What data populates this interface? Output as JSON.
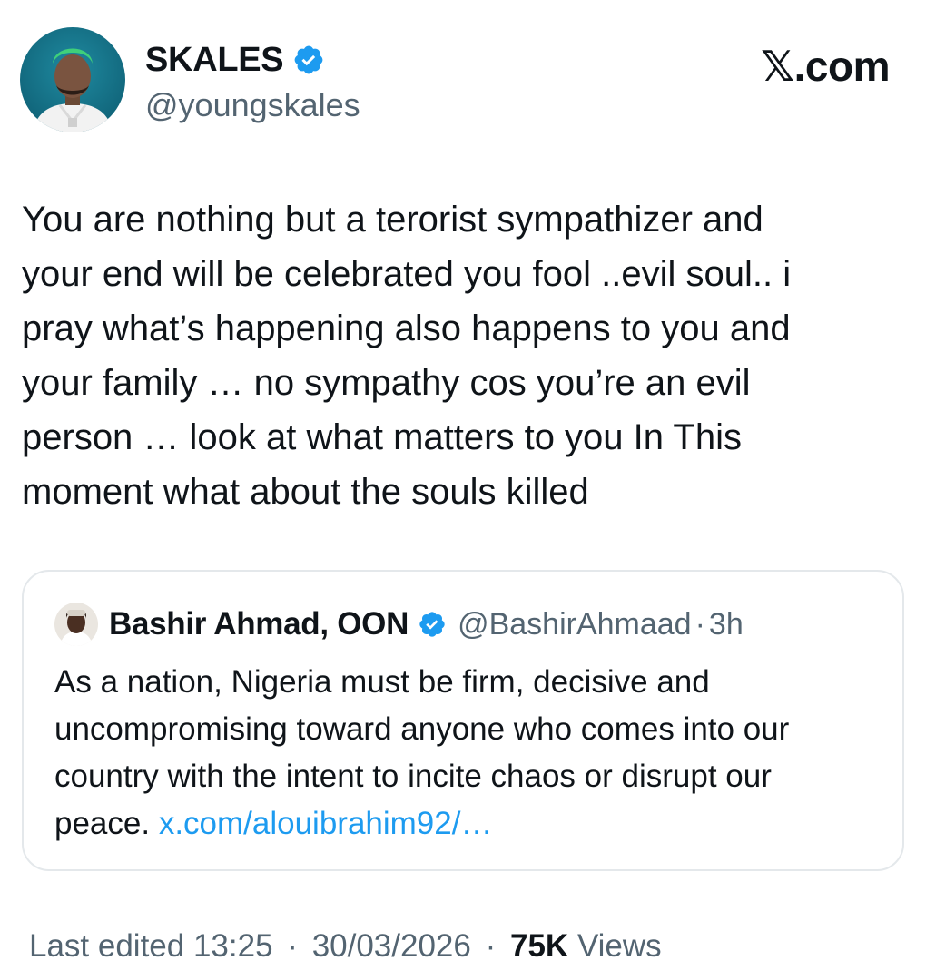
{
  "author": {
    "name": "SKALES",
    "handle": "@youngskales",
    "verified": true
  },
  "site_mark": "𝕏.com",
  "tweet": {
    "text": "You are nothing but a terorist sympathizer and\nyour end will be celebrated you fool ..evil soul.. i\npray what’s happening also happens to you and\nyour family … no sympathy cos you’re an evil\nperson … look at what matters to you In This\nmoment what about the souls killed"
  },
  "quoted_tweet": {
    "name": "Bashir Ahmad, OON",
    "handle": "@BashirAhmaad",
    "separator": "·",
    "time": "3h",
    "text": "As a nation, Nigeria must be firm, decisive and uncompromising toward anyone who comes into our country with the intent to incite chaos or disrupt our peace. ",
    "link_text": "x.com/alouibrahim92/…"
  },
  "meta": {
    "edited_label": "Last edited 13:25",
    "separator": "·",
    "date": "30/03/2026",
    "views_count": "75K",
    "views_label": "Views"
  },
  "icons": {
    "verified": "verified-badge-icon"
  },
  "colors": {
    "text": "#0f1419",
    "secondary": "#536471",
    "link": "#1d9bf0",
    "verified": "#1d9bf0",
    "border": "#e4e8eb"
  }
}
